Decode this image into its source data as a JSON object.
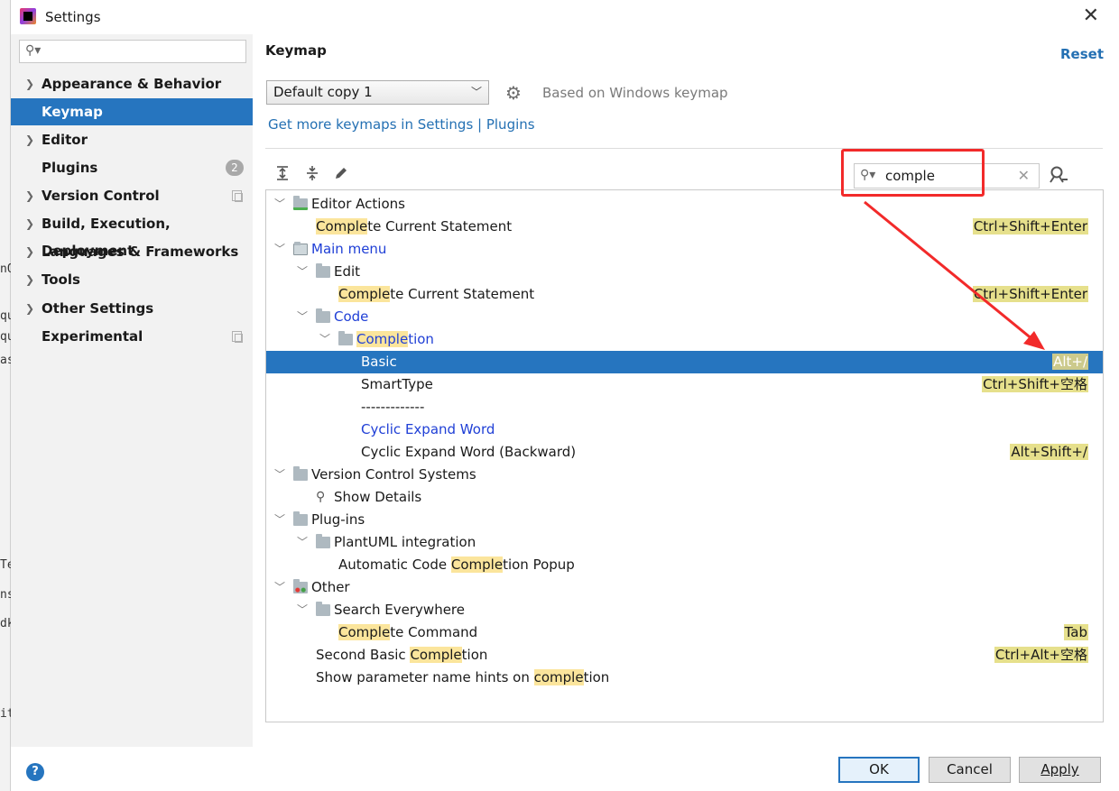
{
  "window": {
    "title": "Settings",
    "close_glyph": "✕"
  },
  "background_fragments": [
    "nQ",
    "qu",
    "qu",
    "as",
    "Te",
    "ns",
    "dk",
    "it"
  ],
  "sidebar": {
    "search_placeholder": "",
    "items": [
      {
        "label": "Appearance & Behavior",
        "expandable": true
      },
      {
        "label": "Keymap",
        "expandable": false,
        "selected": true
      },
      {
        "label": "Editor",
        "expandable": true
      },
      {
        "label": "Plugins",
        "expandable": false,
        "badge": "2"
      },
      {
        "label": "Version Control",
        "expandable": true
      },
      {
        "label": "Build, Execution, Deployment",
        "expandable": true
      },
      {
        "label": "Languages & Frameworks",
        "expandable": true
      },
      {
        "label": "Tools",
        "expandable": true
      },
      {
        "label": "Other Settings",
        "expandable": true
      },
      {
        "label": "Experimental",
        "expandable": false
      }
    ]
  },
  "help_label": "?",
  "panel": {
    "title": "Keymap",
    "reset_label": "Reset",
    "keymap_selected": "Default copy 1",
    "based_on": "Based on Windows keymap",
    "get_more_link": "Get more keymaps in Settings | Plugins",
    "search_value": "comple"
  },
  "tree": [
    {
      "text": "Editor Actions",
      "level": 0,
      "expanded": true,
      "icon": "editor-actions-icon"
    },
    {
      "pre": "",
      "hl": "Comple",
      "post": "te Current Statement",
      "level": 1,
      "shortcut": "Ctrl+Shift+Enter"
    },
    {
      "text": "Main menu",
      "level": 0,
      "expanded": true,
      "icon": "menu-icon",
      "blue": true
    },
    {
      "text": "Edit",
      "level": 1,
      "expanded": true,
      "icon": "folder-icon"
    },
    {
      "pre": "",
      "hl": "Comple",
      "post": "te Current Statement",
      "level": 2,
      "shortcut": "Ctrl+Shift+Enter"
    },
    {
      "text": "Code",
      "level": 1,
      "expanded": true,
      "icon": "folder-icon",
      "blue": true
    },
    {
      "pre": "",
      "hl": "Comple",
      "post": "tion",
      "level": 2,
      "expanded": true,
      "icon": "folder-icon",
      "blue": true
    },
    {
      "text": "Basic",
      "level": 3,
      "shortcut": "Alt+/",
      "selected": true
    },
    {
      "text": "SmartType",
      "level": 3,
      "shortcut": "Ctrl+Shift+空格"
    },
    {
      "text": "-------------",
      "level": 3
    },
    {
      "text": "Cyclic Expand Word",
      "level": 3,
      "blue": true
    },
    {
      "text": "Cyclic Expand Word (Backward)",
      "level": 3,
      "shortcut": "Alt+Shift+/"
    },
    {
      "text": "Version Control Systems",
      "level": 0,
      "expanded": true,
      "icon": "folder-icon"
    },
    {
      "text": "Show Details",
      "level": 1,
      "icon": "search-icon"
    },
    {
      "text": "Plug-ins",
      "level": 0,
      "expanded": true,
      "icon": "folder-icon"
    },
    {
      "text": "PlantUML integration",
      "level": 1,
      "expanded": true,
      "icon": "folder-icon"
    },
    {
      "pre": "Automatic Code ",
      "hl": "Comple",
      "post": "tion Popup",
      "level": 2
    },
    {
      "text": "Other",
      "level": 0,
      "expanded": true,
      "icon": "other-icon"
    },
    {
      "text": "Search Everywhere",
      "level": 1,
      "expanded": true,
      "icon": "folder-icon"
    },
    {
      "pre": "",
      "hl": "Comple",
      "post": "te Command",
      "level": 2,
      "shortcut": "Tab"
    },
    {
      "pre": "Second Basic ",
      "hl": "Comple",
      "post": "tion",
      "level": 1,
      "shortcut": "Ctrl+Alt+空格"
    },
    {
      "pre": "Show parameter name hints on ",
      "hl": "comple",
      "post": "tion",
      "level": 1
    }
  ],
  "buttons": {
    "ok": "OK",
    "cancel": "Cancel",
    "apply": "Apply"
  },
  "colors": {
    "selection": "#2675bf",
    "highlight": "#fbe59c",
    "annotation_red": "#f22a2a",
    "link": "#2470b3"
  }
}
